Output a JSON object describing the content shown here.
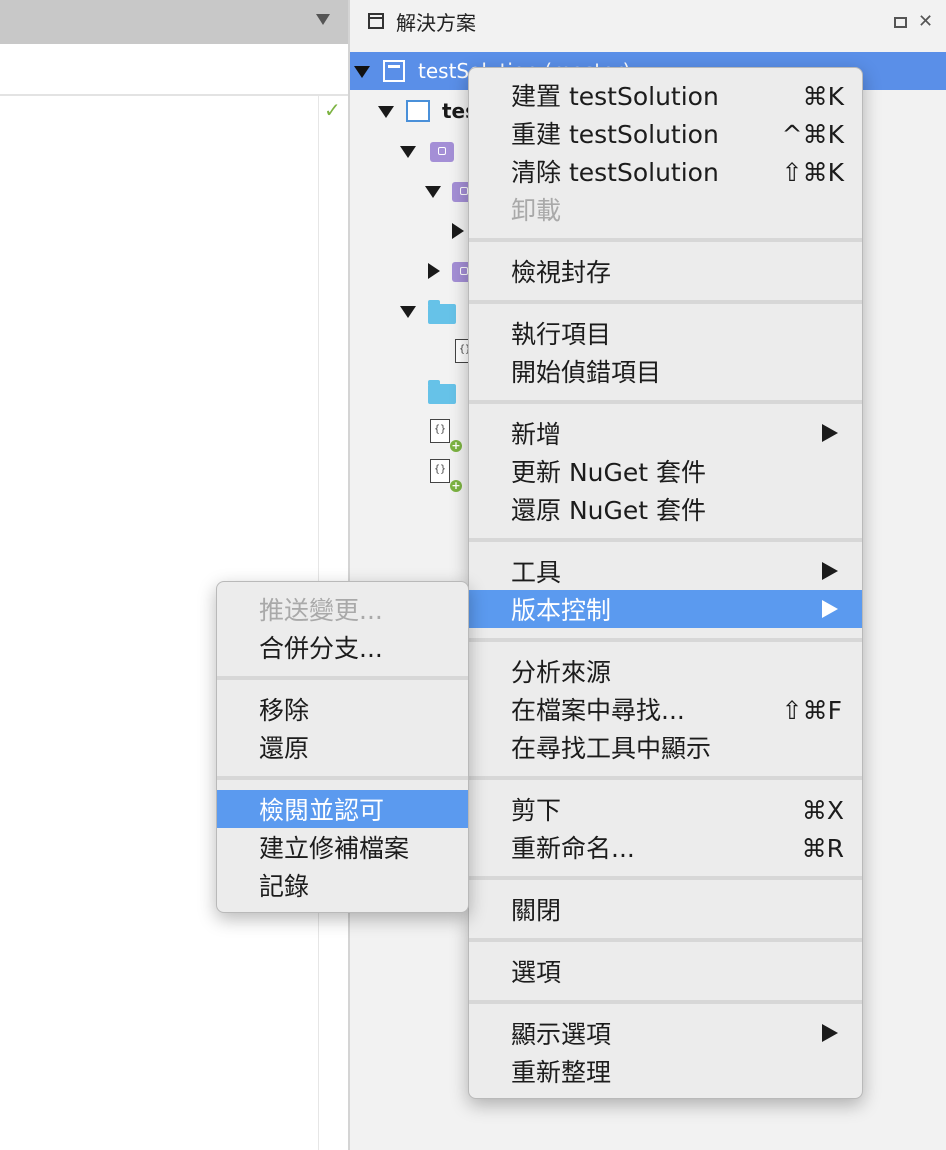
{
  "pad": {
    "title": "解決方案",
    "tree": {
      "solution_label": "testSolution (master)",
      "project_label": "tes"
    }
  },
  "context_menu": {
    "items": [
      {
        "label": "建置 testSolution",
        "shortcut": "⌘K"
      },
      {
        "label": "重建 testSolution",
        "shortcut": "^⌘K"
      },
      {
        "label": "清除 testSolution",
        "shortcut": "⇧⌘K"
      },
      {
        "label": "卸載",
        "disabled": true
      },
      {
        "label": "檢視封存"
      },
      {
        "label": "執行項目"
      },
      {
        "label": "開始偵錯項目"
      },
      {
        "label": "新增",
        "submenu": true
      },
      {
        "label": "更新 NuGet 套件"
      },
      {
        "label": "還原 NuGet 套件"
      },
      {
        "label": "工具",
        "submenu": true
      },
      {
        "label": "版本控制",
        "submenu": true,
        "highlighted": true
      },
      {
        "label": "分析來源"
      },
      {
        "label": "在檔案中尋找...",
        "shortcut": "⇧⌘F"
      },
      {
        "label": "在尋找工具中顯示"
      },
      {
        "label": "剪下",
        "shortcut": "⌘X"
      },
      {
        "label": "重新命名...",
        "shortcut": "⌘R"
      },
      {
        "label": "關閉"
      },
      {
        "label": "選項"
      },
      {
        "label": "顯示選項",
        "submenu": true
      },
      {
        "label": "重新整理"
      }
    ]
  },
  "version_control_submenu": {
    "items": [
      {
        "label": "推送變更...",
        "disabled": true
      },
      {
        "label": "合併分支..."
      },
      {
        "label": "移除"
      },
      {
        "label": "還原"
      },
      {
        "label": "檢閱並認可",
        "highlighted": true
      },
      {
        "label": "建立修補檔案"
      },
      {
        "label": "記錄"
      }
    ]
  },
  "icons": {
    "status": "checkmark-icon",
    "maximize": "maximize-icon",
    "close": "close-icon",
    "close_glyph": "✕",
    "check_glyph": "✓"
  },
  "colors": {
    "selection": "#5a8fe8",
    "menu_highlight": "#5b9aef",
    "folder": "#66c2e8",
    "package": "#a48fd6",
    "status_green": "#7cb342"
  }
}
